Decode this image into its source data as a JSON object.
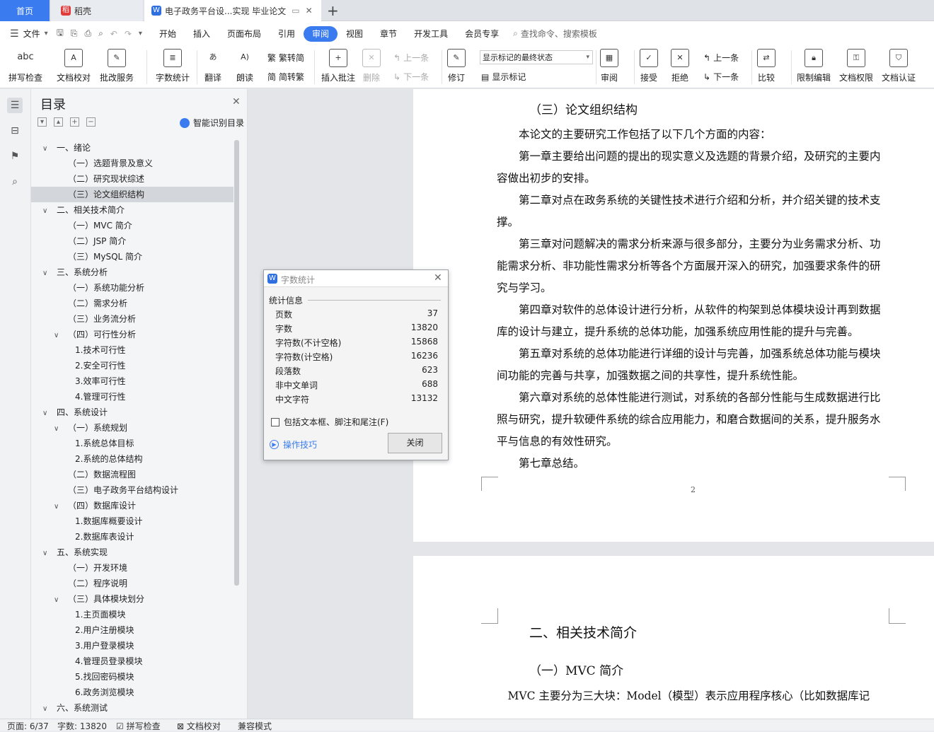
{
  "tabs": {
    "home": "首页",
    "daoke": "稻壳",
    "doc": "电子政务平台设...实现 毕业论文"
  },
  "menu": {
    "file": "文件",
    "items": [
      "开始",
      "插入",
      "页面布局",
      "引用",
      "审阅",
      "视图",
      "章节",
      "开发工具",
      "会员专享"
    ],
    "search": "查找命令、搜索模板"
  },
  "ribbon": {
    "spell": "拼写检查",
    "proof": "文档校对",
    "batch": "批改服务",
    "wordcount": "字数统计",
    "translate": "翻译",
    "read": "朗读",
    "trad": "繁转简",
    "simp": "简转繁",
    "insert_comment": "插入批注",
    "delete": "删除",
    "prev": "上一条",
    "next": "下一条",
    "revise": "修订",
    "markup_state": "显示标记的最终状态",
    "show_markup": "显示标记",
    "review": "审阅",
    "accept": "接受",
    "reject": "拒绝",
    "prev2": "上一条",
    "next2": "下一条",
    "compare": "比较",
    "restrict": "限制编辑",
    "perm": "文档权限",
    "cert": "文档认证",
    "abc": "abc"
  },
  "toc": {
    "title": "目录",
    "smart": "智能识别目录",
    "items": [
      {
        "t": "一、绪论",
        "lvl": 0,
        "exp": true
      },
      {
        "t": "（一）选题背景及意义",
        "lvl": 1
      },
      {
        "t": "（二）研究现状综述",
        "lvl": 1
      },
      {
        "t": "（三）论文组织结构",
        "lvl": 1,
        "sel": true
      },
      {
        "t": "二、相关技术简介",
        "lvl": 0,
        "exp": true
      },
      {
        "t": "（一）MVC 简介",
        "lvl": 1
      },
      {
        "t": "（二）JSP 简介",
        "lvl": 1
      },
      {
        "t": "（三）MySQL 简介",
        "lvl": 1
      },
      {
        "t": "三、系统分析",
        "lvl": 0,
        "exp": true
      },
      {
        "t": "（一）系统功能分析",
        "lvl": 1
      },
      {
        "t": "（二）需求分析",
        "lvl": 1
      },
      {
        "t": "（三）业务流分析",
        "lvl": 1
      },
      {
        "t": "（四）可行性分析",
        "lvl": 1,
        "exp": true
      },
      {
        "t": "1.技术可行性",
        "lvl": 2
      },
      {
        "t": "2.安全可行性",
        "lvl": 2
      },
      {
        "t": "3.效率可行性",
        "lvl": 2
      },
      {
        "t": "4.管理可行性",
        "lvl": 2
      },
      {
        "t": "四、系统设计",
        "lvl": 0,
        "exp": true
      },
      {
        "t": "（一）系统规划",
        "lvl": 1,
        "exp": true
      },
      {
        "t": "1.系统总体目标",
        "lvl": 2
      },
      {
        "t": "2.系统的总体结构",
        "lvl": 2
      },
      {
        "t": "（二）数据流程图",
        "lvl": 1
      },
      {
        "t": "（三）电子政务平台结构设计",
        "lvl": 1
      },
      {
        "t": "（四）数据库设计",
        "lvl": 1,
        "exp": true
      },
      {
        "t": "1.数据库概要设计",
        "lvl": 2
      },
      {
        "t": "2.数据库表设计",
        "lvl": 2
      },
      {
        "t": "五、系统实现",
        "lvl": 0,
        "exp": true
      },
      {
        "t": "（一）开发环境",
        "lvl": 1
      },
      {
        "t": "（二）程序说明",
        "lvl": 1
      },
      {
        "t": "（三）具体模块划分",
        "lvl": 1,
        "exp": true
      },
      {
        "t": "1.主页面模块",
        "lvl": 2
      },
      {
        "t": "2.用户注册模块",
        "lvl": 2
      },
      {
        "t": "3.用户登录模块",
        "lvl": 2
      },
      {
        "t": "4.管理员登录模块",
        "lvl": 2
      },
      {
        "t": "5.找回密码模块",
        "lvl": 2
      },
      {
        "t": "6.政务浏览模块",
        "lvl": 2
      },
      {
        "t": "六、系统测试",
        "lvl": 0,
        "exp": true
      }
    ]
  },
  "doc": {
    "heading": "（三）论文组织结构",
    "lines": [
      "　　本论文的主要研究工作包括了以下几个方面的内容：",
      "　　第一章主要给出问题的提出的现实意义及选题的背景介绍，及研究的主要内",
      "容做出初步的安排。",
      "　　第二章对点在政务系统的关键性技术进行介绍和分析，并介绍关键的技术支",
      "撑。",
      "　　第三章对问题解决的需求分析来源与很多部分，主要分为业务需求分析、功",
      "能需求分析、非功能性需求分析等各个方面展开深入的研究，加强要求条件的研",
      "究与学习。",
      "　　第四章对软件的总体设计进行分析，从软件的构架到总体模块设计再到数据",
      "库的设计与建立，提升系统的总体功能，加强系统应用性能的提升与完善。",
      "　　第五章对系统的总体功能进行详细的设计与完善，加强系统总体功能与模块",
      "间功能的完善与共享，加强数据之间的共享性，提升系统性能。",
      "　　第六章对系统的总体性能进行测试，对系统的各部分性能与生成数据进行比",
      "照与研究，提升软硬件系统的综合应用能力，和磨合数据间的关系，提升服务水",
      "平与信息的有效性研究。",
      "　　第七章总结。"
    ],
    "page_num": "2",
    "h2": "二、相关技术简介",
    "h3": "（一）MVC 简介",
    "last": "　MVC 主要分为三大块：Model（模型）表示应用程序核心（比如数据库记"
  },
  "dialog": {
    "title": "字数统计",
    "section": "统计信息",
    "rows": [
      [
        "页数",
        "37"
      ],
      [
        "字数",
        "13820"
      ],
      [
        "字符数(不计空格)",
        "15868"
      ],
      [
        "字符数(计空格)",
        "16236"
      ],
      [
        "段落数",
        "623"
      ],
      [
        "非中文单词",
        "688"
      ],
      [
        "中文字符",
        "13132"
      ]
    ],
    "checkbox": "包括文本框、脚注和尾注(F)",
    "tips": "操作技巧",
    "close": "关闭"
  },
  "status": {
    "page": "页面: 6/37",
    "words": "字数: 13820",
    "spell": "拼写检查",
    "proof": "文档校对",
    "compat": "兼容模式"
  }
}
